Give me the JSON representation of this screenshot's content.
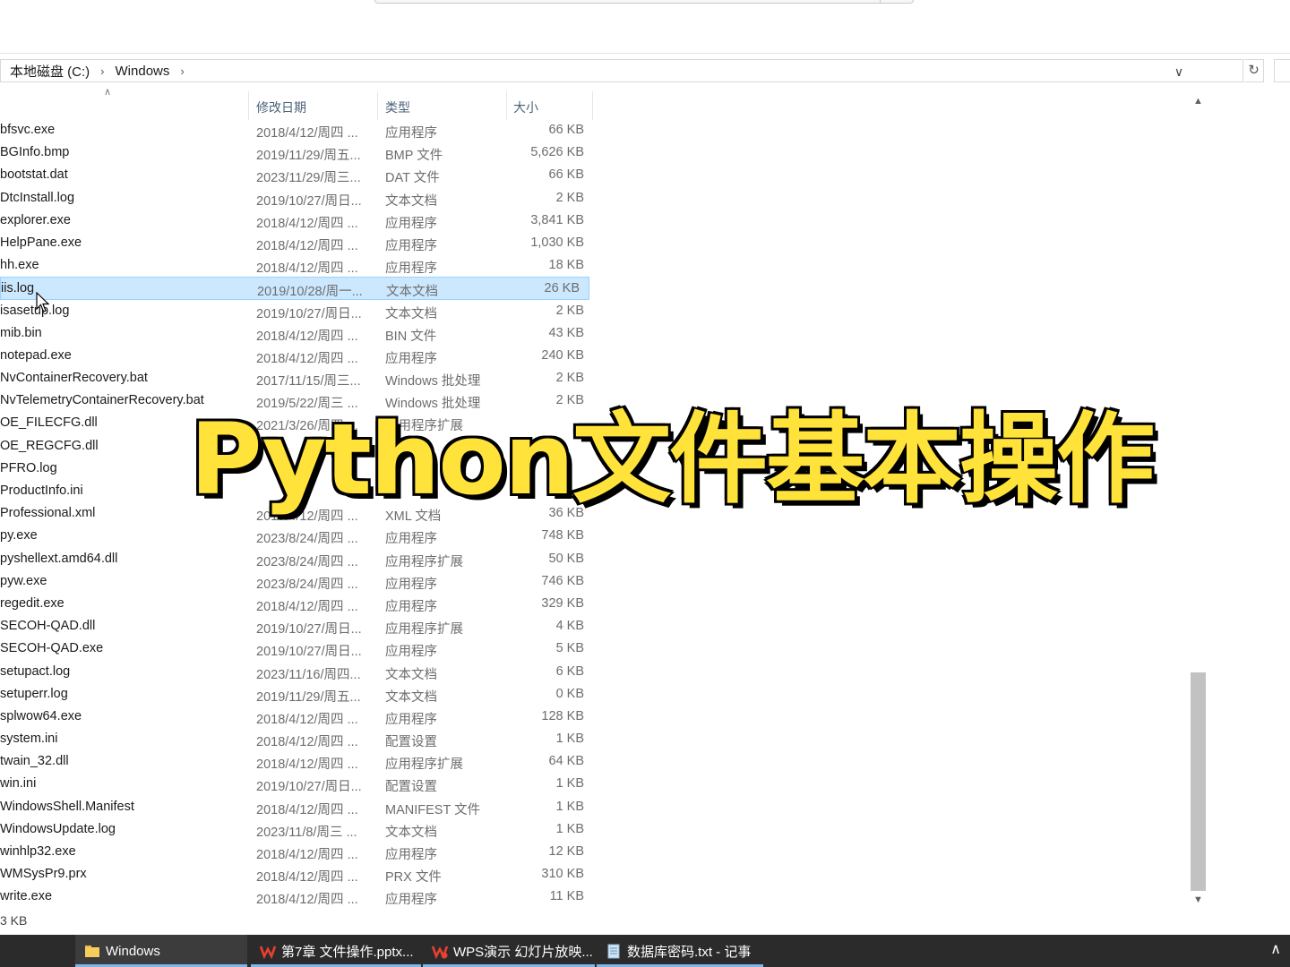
{
  "address": {
    "crumbs": [
      "本地磁盘 (C:)",
      "Windows"
    ],
    "dropdown_icon": "chevron-down-icon",
    "refresh_icon": "refresh-icon"
  },
  "columns": {
    "name": "",
    "date": "修改日期",
    "type": "类型",
    "size": "大小"
  },
  "files": [
    {
      "name": "bfsvc.exe",
      "date": "2018/4/12/周四 ...",
      "type": "应用程序",
      "size": "66 KB"
    },
    {
      "name": "BGInfo.bmp",
      "date": "2019/11/29/周五...",
      "type": "BMP 文件",
      "size": "5,626 KB"
    },
    {
      "name": "bootstat.dat",
      "date": "2023/11/29/周三...",
      "type": "DAT 文件",
      "size": "66 KB"
    },
    {
      "name": "DtcInstall.log",
      "date": "2019/10/27/周日...",
      "type": "文本文档",
      "size": "2 KB"
    },
    {
      "name": "explorer.exe",
      "date": "2018/4/12/周四 ...",
      "type": "应用程序",
      "size": "3,841 KB"
    },
    {
      "name": "HelpPane.exe",
      "date": "2018/4/12/周四 ...",
      "type": "应用程序",
      "size": "1,030 KB"
    },
    {
      "name": "hh.exe",
      "date": "2018/4/12/周四 ...",
      "type": "应用程序",
      "size": "18 KB"
    },
    {
      "name": "iis.log",
      "date": "2019/10/28/周一...",
      "type": "文本文档",
      "size": "26 KB",
      "selected": true
    },
    {
      "name": "isasetup.log",
      "date": "2019/10/27/周日...",
      "type": "文本文档",
      "size": "2 KB"
    },
    {
      "name": "mib.bin",
      "date": "2018/4/12/周四 ...",
      "type": "BIN 文件",
      "size": "43 KB"
    },
    {
      "name": "notepad.exe",
      "date": "2018/4/12/周四 ...",
      "type": "应用程序",
      "size": "240 KB"
    },
    {
      "name": "NvContainerRecovery.bat",
      "date": "2017/11/15/周三...",
      "type": "Windows 批处理",
      "size": "2 KB"
    },
    {
      "name": "NvTelemetryContainerRecovery.bat",
      "date": "2019/5/22/周三 ...",
      "type": "Windows 批处理",
      "size": "2 KB"
    },
    {
      "name": "OE_FILECFG.dll",
      "date": "2021/3/26/周四 ...",
      "type": "应用程序扩展",
      "size": ""
    },
    {
      "name": "OE_REGCFG.dll",
      "date": "",
      "type": "",
      "size": ""
    },
    {
      "name": "PFRO.log",
      "date": "",
      "type": "",
      "size": ""
    },
    {
      "name": "ProductInfo.ini",
      "date": "",
      "type": "",
      "size": ""
    },
    {
      "name": "Professional.xml",
      "date": "2019/4/12/周四 ...",
      "type": "XML 文档",
      "size": "36 KB"
    },
    {
      "name": "py.exe",
      "date": "2023/8/24/周四 ...",
      "type": "应用程序",
      "size": "748 KB"
    },
    {
      "name": "pyshellext.amd64.dll",
      "date": "2023/8/24/周四 ...",
      "type": "应用程序扩展",
      "size": "50 KB"
    },
    {
      "name": "pyw.exe",
      "date": "2023/8/24/周四 ...",
      "type": "应用程序",
      "size": "746 KB"
    },
    {
      "name": "regedit.exe",
      "date": "2018/4/12/周四 ...",
      "type": "应用程序",
      "size": "329 KB"
    },
    {
      "name": "SECOH-QAD.dll",
      "date": "2019/10/27/周日...",
      "type": "应用程序扩展",
      "size": "4 KB"
    },
    {
      "name": "SECOH-QAD.exe",
      "date": "2019/10/27/周日...",
      "type": "应用程序",
      "size": "5 KB"
    },
    {
      "name": "setupact.log",
      "date": "2023/11/16/周四...",
      "type": "文本文档",
      "size": "6 KB"
    },
    {
      "name": "setuperr.log",
      "date": "2019/11/29/周五...",
      "type": "文本文档",
      "size": "0 KB"
    },
    {
      "name": "splwow64.exe",
      "date": "2018/4/12/周四 ...",
      "type": "应用程序",
      "size": "128 KB"
    },
    {
      "name": "system.ini",
      "date": "2018/4/12/周四 ...",
      "type": "配置设置",
      "size": "1 KB"
    },
    {
      "name": "twain_32.dll",
      "date": "2018/4/12/周四 ...",
      "type": "应用程序扩展",
      "size": "64 KB"
    },
    {
      "name": "win.ini",
      "date": "2019/10/27/周日...",
      "type": "配置设置",
      "size": "1 KB"
    },
    {
      "name": "WindowsShell.Manifest",
      "date": "2018/4/12/周四 ...",
      "type": "MANIFEST 文件",
      "size": "1 KB"
    },
    {
      "name": "WindowsUpdate.log",
      "date": "2023/11/8/周三 ...",
      "type": "文本文档",
      "size": "1 KB"
    },
    {
      "name": "winhlp32.exe",
      "date": "2018/4/12/周四 ...",
      "type": "应用程序",
      "size": "12 KB"
    },
    {
      "name": "WMSysPr9.prx",
      "date": "2018/4/12/周四 ...",
      "type": "PRX 文件",
      "size": "310 KB"
    },
    {
      "name": "write.exe",
      "date": "2018/4/12/周四 ...",
      "type": "应用程序",
      "size": "11 KB"
    }
  ],
  "scrollbar": {
    "thumb_start_fraction": 0.72,
    "thumb_end_fraction": 1.0
  },
  "status_text": "3 KB",
  "overlay_title": "Python文件基本操作",
  "taskbar": {
    "items": [
      {
        "label": "Windows",
        "icon": "folder-icon",
        "active": true
      },
      {
        "label": "第7章 文件操作.pptx...",
        "icon": "wps-icon",
        "active": false
      },
      {
        "label": "WPS演示 幻灯片放映...",
        "icon": "wps-icon",
        "active": false
      },
      {
        "label": "数据库密码.txt - 记事",
        "icon": "notepad-icon",
        "active": false
      }
    ],
    "tray_icon": "chevron-up-icon"
  },
  "colors": {
    "selection": "#cce8ff",
    "selection_border": "#99d1ff",
    "header_text": "#4c607a",
    "overlay_fill": "#ffe23a",
    "taskbar": "#2b2b2b",
    "taskbar_underline": "#7fb6e8"
  }
}
